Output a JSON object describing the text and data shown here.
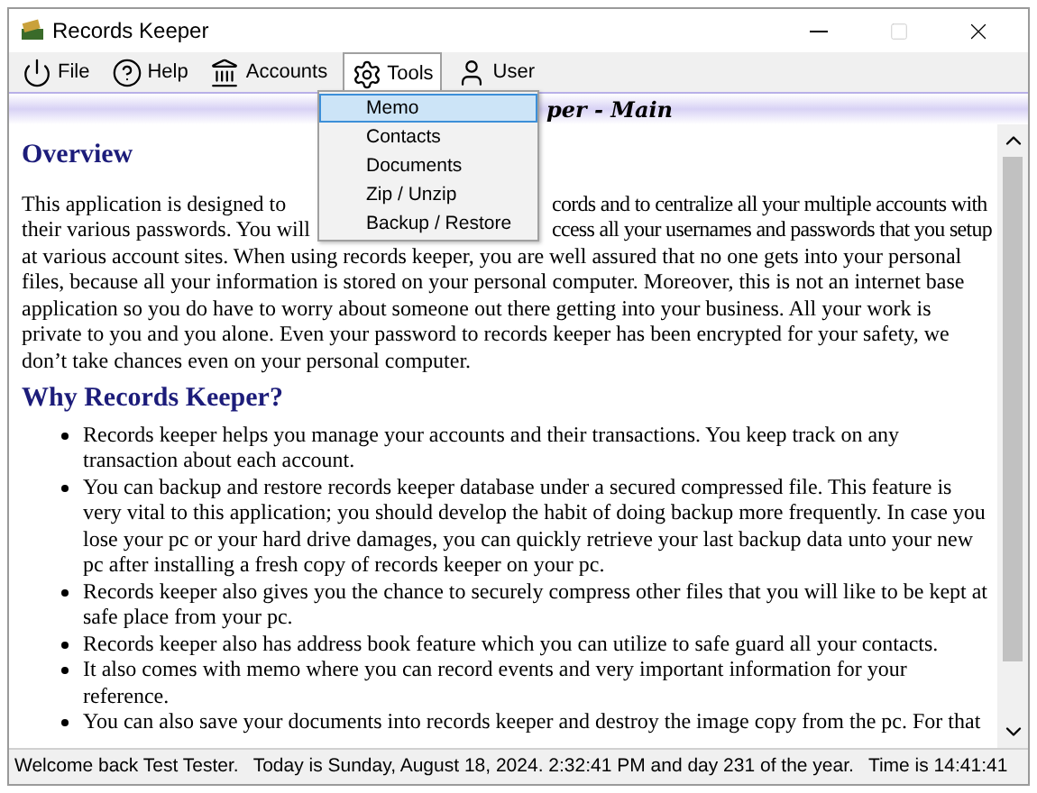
{
  "window": {
    "title": "Records Keeper"
  },
  "menu_bar": [
    {
      "label": "File",
      "selected": false
    },
    {
      "label": "Help",
      "selected": false
    },
    {
      "label": "Accounts",
      "selected": false
    },
    {
      "label": "Tools",
      "selected": true
    },
    {
      "label": "User",
      "selected": false
    }
  ],
  "tools_menu": [
    {
      "label": "Memo",
      "selected": true
    },
    {
      "label": "Contacts",
      "selected": false
    },
    {
      "label": "Documents",
      "selected": false
    },
    {
      "label": "Zip / Unzip",
      "selected": false
    },
    {
      "label": "Backup / Restore",
      "selected": false
    }
  ],
  "banner": {
    "title": "per - Main"
  },
  "document": {
    "overview_heading": "Overview",
    "overview_lines_partial": [
      {
        "left": "This application is designed to",
        "right": "cords and to centralize all your multiple accounts with"
      },
      {
        "left": "their various passwords. You will",
        "right": "ccess all your usernames and passwords that you setup"
      }
    ],
    "overview_rest": "at various account sites. When using records keeper, you are well assured that no one gets into your personal files, because all your information is stored on your personal computer. Moreover, this is not an internet base application so you do have to worry about someone out there getting into your business. All your work is private to you and you alone. Even your password to records keeper has been encrypted for your safety, we don’t take chances even on your personal computer.",
    "why_heading": "Why Records Keeper?",
    "bullets": [
      "Records keeper helps you manage your accounts and their transactions. You keep track on any transaction about each account.",
      "You can backup and restore records keeper database under a secured compressed file. This feature is very vital to this application; you should develop the habit of doing backup more frequently. In case you lose your pc or your hard drive damages, you can quickly retrieve your last backup data unto your new pc after installing a fresh copy of records keeper on your pc.",
      "Records keeper also gives you the chance to securely compress other files that you will like to be kept at safe place from your pc.",
      "Records keeper also has address book feature which you can utilize to safe guard all your contacts.",
      "It also comes with memo where you can record events and very important information for your reference.",
      "You can also save your documents into records keeper and destroy the image copy from the pc. For that"
    ]
  },
  "status_bar": [
    "Welcome back Test Tester.",
    "Today is Sunday, August 18, 2024. 2:32:41 PM and day 231 of the year.",
    "Time is 14:41:41"
  ]
}
